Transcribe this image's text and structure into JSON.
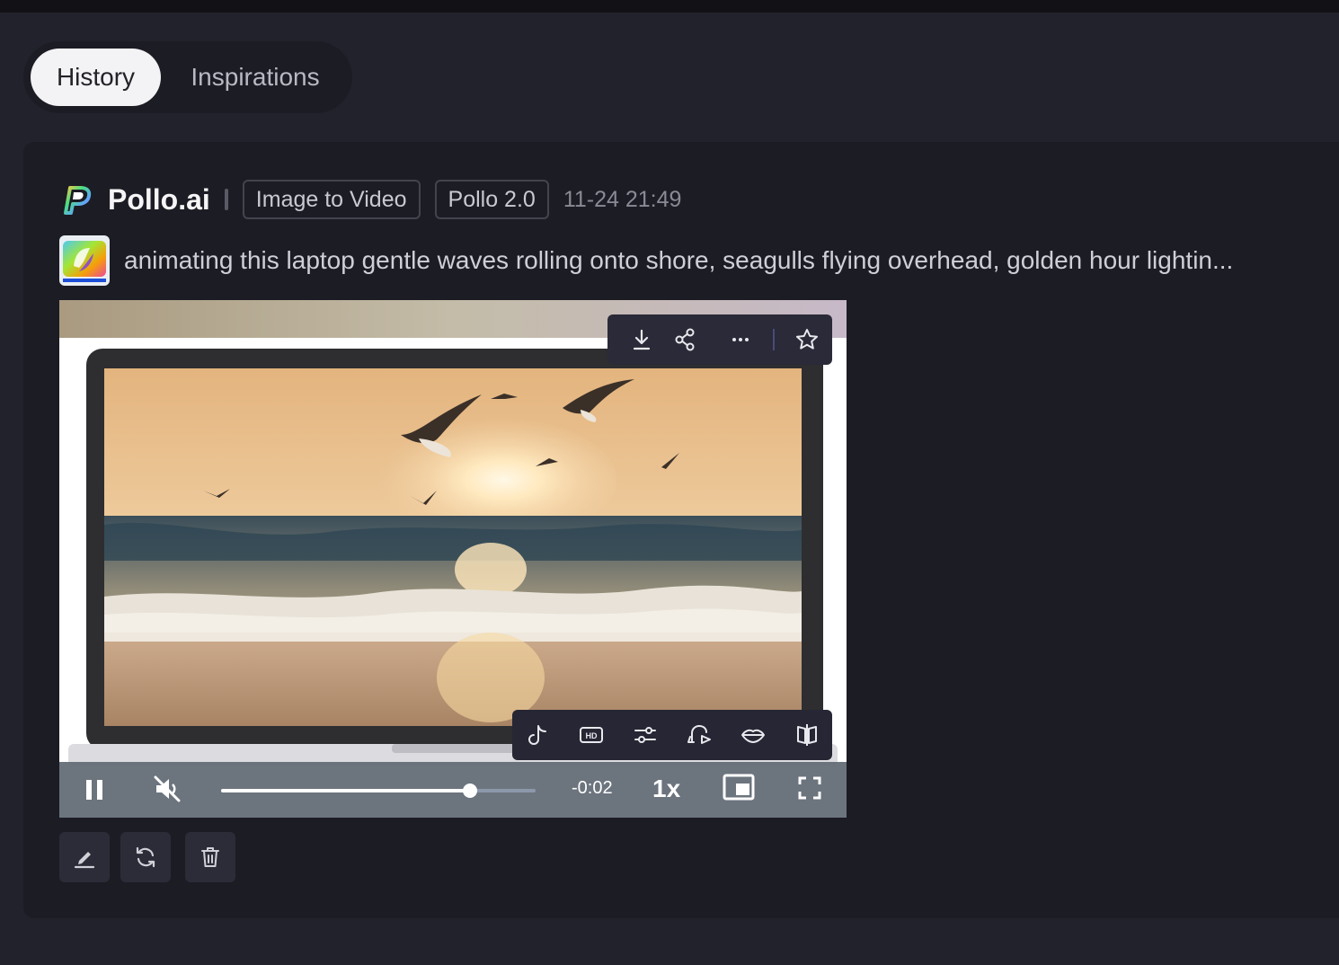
{
  "tabs": [
    {
      "label": "History",
      "active": true
    },
    {
      "label": "Inspirations",
      "active": false
    }
  ],
  "item": {
    "brand": "Pollo.ai",
    "mode": "Image to Video",
    "model": "Pollo 2.0",
    "timestamp": "11-24 21:49",
    "prompt": "animating this laptop gentle waves rolling onto shore, seagulls flying overhead, golden hour lightin...",
    "thumbnail_icon": "copilot-logo-thumbnail"
  },
  "video_toolbar": {
    "top": [
      "download-icon",
      "share-icon",
      "more-icon",
      "star-icon"
    ],
    "bottom": [
      "tiktok-icon",
      "hd-icon",
      "sliders-icon",
      "video-reface-icon",
      "lips-icon",
      "compare-icon"
    ]
  },
  "player": {
    "time_remaining": "-0:02",
    "speed": "1x",
    "progress": 0.79,
    "state": "playing",
    "muted": true
  },
  "actions": [
    "edit-icon",
    "regenerate-icon",
    "delete-icon"
  ],
  "colors": {
    "background": "#22222c",
    "card": "#1c1c24",
    "tab_active": "#f3f3f5"
  }
}
